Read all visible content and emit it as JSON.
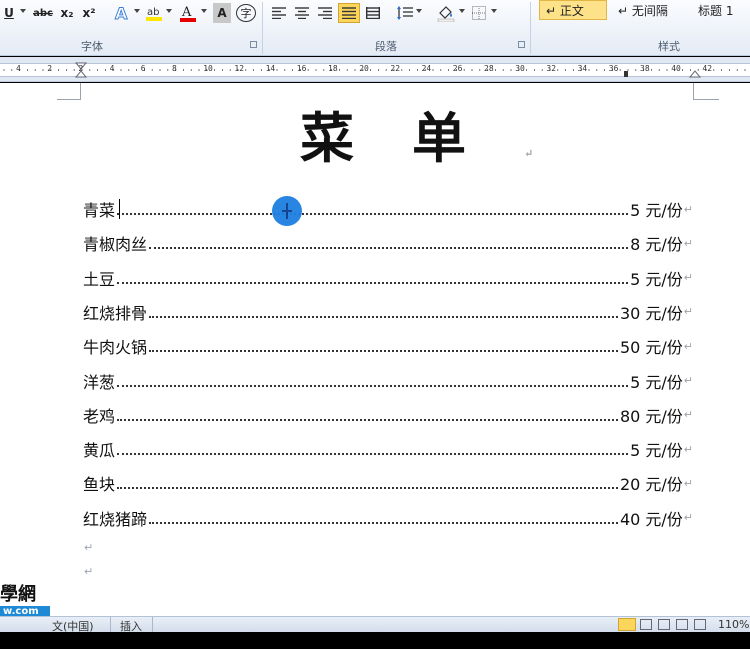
{
  "ribbon": {
    "groups": {
      "font": "字体",
      "paragraph": "段落",
      "styles": "样式"
    },
    "styles": [
      "↵ 正文",
      "↵ 无间隔",
      "标题 1"
    ],
    "font_buttons": {
      "underline": "U",
      "strike": "abc",
      "subscript": "x₂",
      "superscript": "x²",
      "char_border": "A",
      "phonetic": "字"
    }
  },
  "ruler": {
    "ticks": [
      "4",
      "2",
      "2",
      "4",
      "6",
      "8",
      "10",
      "12",
      "14",
      "16",
      "18",
      "20",
      "22",
      "24",
      "26",
      "28",
      "30",
      "32",
      "34",
      "36",
      "38",
      "40",
      "42"
    ]
  },
  "document": {
    "title": "菜单",
    "menu": [
      {
        "name": "青菜",
        "price": "5 元/份"
      },
      {
        "name": "青椒肉丝",
        "price": "8 元/份"
      },
      {
        "name": "土豆",
        "price": "5 元/份"
      },
      {
        "name": "红烧排骨",
        "price": "30 元/份"
      },
      {
        "name": "牛肉火锅",
        "price": "50 元/份"
      },
      {
        "name": "洋葱",
        "price": "5 元/份"
      },
      {
        "name": "老鸡",
        "price": "80 元/份"
      },
      {
        "name": "黄瓜",
        "price": "5 元/份"
      },
      {
        "name": "鱼块",
        "price": "20 元/份"
      },
      {
        "name": "红烧猪蹄",
        "price": "40 元/份"
      }
    ],
    "pilcrow": "↵"
  },
  "watermark": {
    "top": "學網",
    "bottom": "w.com"
  },
  "status": {
    "language": "文(中国)",
    "mode": "插入",
    "zoom": "110%"
  }
}
